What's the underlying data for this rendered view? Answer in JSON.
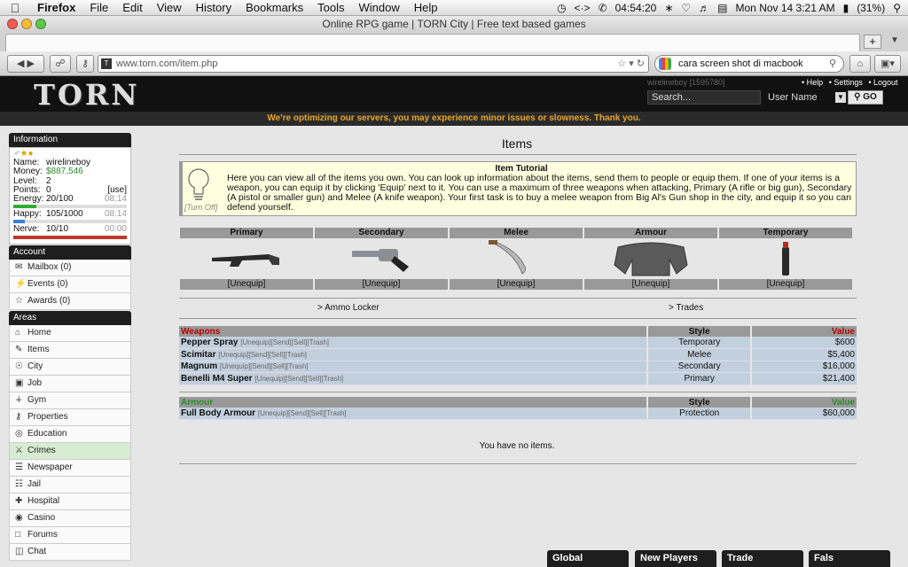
{
  "macmenu": {
    "app": "Firefox",
    "items": [
      "File",
      "Edit",
      "View",
      "History",
      "Bookmarks",
      "Tools",
      "Window",
      "Help"
    ],
    "clock": "04:54:20",
    "datetime": "Mon Nov 14  3:21 AM",
    "battery": "(31%)"
  },
  "browser": {
    "window_title": "Online RPG game | TORN City | Free text based games",
    "url": "www.torn.com/item.php",
    "search_value": "cara screen shot di macbook"
  },
  "header": {
    "logo": "TORN",
    "user_line": "wirelineboy [1595780]",
    "links": [
      "• Help",
      "• Settings",
      "• Logout"
    ],
    "search_placeholder": "Search...",
    "search_type": "User Name",
    "go_label": "GO"
  },
  "notice": "We're optimizing our servers, you may experience minor issues or slowness. Thank you.",
  "sidebar": {
    "info_title": "Information",
    "info": {
      "name_label": "Name:",
      "name": "wirelineboy",
      "money_label": "Money:",
      "money": "$887,546",
      "level_label": "Level:",
      "level": "2",
      "points_label": "Points:",
      "points": "0",
      "points_use": "[use]",
      "energy_label": "Energy:",
      "energy": "20/100",
      "energy_time": "08:14",
      "energy_fraction": 0.2,
      "happy_label": "Happy:",
      "happy": "105/1000",
      "happy_time": "08:14",
      "happy_fraction": 0.105,
      "nerve_label": "Nerve:",
      "nerve": "10/10",
      "nerve_time": "00:00",
      "nerve_fraction": 1.0
    },
    "account_title": "Account",
    "account": [
      "Mailbox (0)",
      "Events (0)",
      "Awards (0)"
    ],
    "areas_title": "Areas",
    "areas": [
      "Home",
      "Items",
      "City",
      "Job",
      "Gym",
      "Properties",
      "Education",
      "Crimes",
      "Newspaper",
      "Jail",
      "Hospital",
      "Casino",
      "Forums",
      "Chat"
    ]
  },
  "main": {
    "title": "Items",
    "tutorial_title": "Item Tutorial",
    "tutorial_text": "Here you can view all of the items you own. You can look up information about the items, send them to people or equip them. If one of your items is a weapon, you can equip it by clicking 'Equip' next to it. You can use a maximum of three weapons when attacking, Primary (A rifle or big gun), Secondary (A pistol or smaller gun) and Melee (A knife weapon). Your first task is to buy a melee weapon from Big Al's Gun shop in the city, and equip it so you can defend yourself.",
    "turn_off": "[Turn Off]",
    "slots": [
      {
        "label": "Primary",
        "action": "[Unequip]"
      },
      {
        "label": "Secondary",
        "action": "[Unequip]"
      },
      {
        "label": "Melee",
        "action": "[Unequip]"
      },
      {
        "label": "Armour",
        "action": "[Unequip]"
      },
      {
        "label": "Temporary",
        "action": "[Unequip]"
      }
    ],
    "ammo_link": "> Ammo Locker",
    "trades_link": "> Trades",
    "weapons_header": {
      "name": "Weapons",
      "style": "Style",
      "value": "Value"
    },
    "weapons": [
      {
        "name": "Pepper Spray",
        "actions": "[Unequip][Send][Sell][Trash]",
        "style": "Temporary",
        "value": "$600"
      },
      {
        "name": "Scimitar",
        "actions": "[Unequip][Send][Sell][Trash]",
        "style": "Melee",
        "value": "$5,400"
      },
      {
        "name": "Magnum",
        "actions": "[Unequip][Send][Sell][Trash]",
        "style": "Secondary",
        "value": "$16,000"
      },
      {
        "name": "Benelli M4 Super",
        "actions": "[Unequip][Send][Sell][Trash]",
        "style": "Primary",
        "value": "$21,400"
      }
    ],
    "armour_header": {
      "name": "Armour",
      "style": "Style",
      "value": "Value"
    },
    "armour": [
      {
        "name": "Full Body Armour",
        "actions": "[Unequip][Send][Sell][Trash]",
        "style": "Protection",
        "value": "$60,000"
      }
    ],
    "no_items": "You have no items."
  },
  "chat_tabs": [
    "Global",
    "New Players",
    "Trade",
    "Fals"
  ],
  "colors": {
    "money": "#2a8a2a",
    "weapons_header": "#b00000",
    "armour_header": "#2a8a2a",
    "notice": "#e8a628",
    "energy": "#2fae2f",
    "happy": "#3b7fd6",
    "nerve": "#c0392b"
  }
}
